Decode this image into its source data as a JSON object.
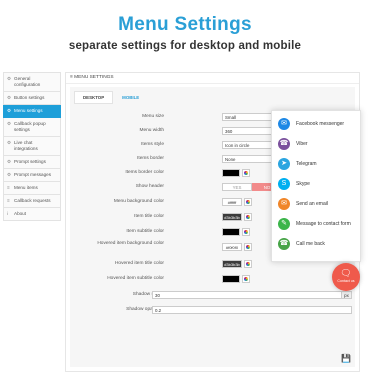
{
  "hero": {
    "title": "Menu Settings",
    "subtitle": "separate settings for desktop and mobile"
  },
  "sidebar": {
    "items": [
      {
        "icon": "gear-icon",
        "glyph": "⚙",
        "label": "General configuration",
        "active": false
      },
      {
        "icon": "gear-icon",
        "glyph": "⚙",
        "label": "Button settings",
        "active": false
      },
      {
        "icon": "gear-icon",
        "glyph": "⚙",
        "label": "Menu settings",
        "active": true
      },
      {
        "icon": "gear-icon",
        "glyph": "⚙",
        "label": "Callback popup settings",
        "active": false
      },
      {
        "icon": "gear-icon",
        "glyph": "⚙",
        "label": "Live chat integrations",
        "active": false
      },
      {
        "icon": "gear-icon",
        "glyph": "⚙",
        "label": "Prompt settings",
        "active": false
      },
      {
        "icon": "gear-icon",
        "glyph": "⚙",
        "label": "Prompt messages",
        "active": false
      },
      {
        "icon": "list-icon",
        "glyph": "≡",
        "label": "Menu items",
        "active": false
      },
      {
        "icon": "list-icon",
        "glyph": "≡",
        "label": "Callback requests",
        "active": false
      },
      {
        "icon": "info-icon",
        "glyph": "i",
        "label": "About",
        "active": false
      }
    ]
  },
  "panel": {
    "title": "MENU SETTINGS",
    "title_icon": "≡",
    "tabs": [
      {
        "label": "DESKTOP",
        "active": true
      },
      {
        "label": "MOBILE",
        "active": false
      }
    ]
  },
  "form": {
    "menu_size": {
      "label": "Menu size",
      "value": "Small"
    },
    "menu_width": {
      "label": "Menu width",
      "value": "360",
      "unit": "px"
    },
    "items_style": {
      "label": "Items style",
      "value": "Icon in circle"
    },
    "items_border": {
      "label": "Items border",
      "value": "None"
    },
    "items_border_color": {
      "label": "Items border color",
      "color": "#000000"
    },
    "show_header": {
      "label": "Show header",
      "yes": "YES",
      "no": "NO"
    },
    "menu_bg_color": {
      "label": "Menu background color",
      "value": "#ffffff"
    },
    "item_title_color": {
      "label": "Item title color",
      "value": "#3b3b3b",
      "color": "#3b3b3b"
    },
    "item_subtitle_color": {
      "label": "Item subtitle color",
      "color": "#000000"
    },
    "hovered_bg_color": {
      "label": "Hovered item background color",
      "value": "#f0f0f0"
    },
    "hovered_title_color": {
      "label": "Hovered item title color",
      "value": "#3b3b3b",
      "color": "#3b3b3b"
    },
    "hovered_subtitle_color": {
      "label": "Hovered item subtitle color",
      "color": "#000000"
    },
    "shadow_size": {
      "label": "Shadow size",
      "value": "30",
      "unit": "px"
    },
    "shadow_opacity": {
      "label": "Shadow opacity",
      "value": "0.2"
    }
  },
  "preview": {
    "items": [
      {
        "label": "Facebook messenger",
        "icon": "messenger-icon",
        "glyph": "✉",
        "color": "#1e88e5"
      },
      {
        "label": "Viber",
        "icon": "viber-icon",
        "glyph": "☎",
        "color": "#7b519d"
      },
      {
        "label": "Telegram",
        "icon": "telegram-icon",
        "glyph": "➤",
        "color": "#2ca5e0"
      },
      {
        "label": "Skype",
        "icon": "skype-icon",
        "glyph": "S",
        "color": "#00aff0"
      },
      {
        "label": "Send an email",
        "icon": "email-icon",
        "glyph": "✉",
        "color": "#f0862a"
      },
      {
        "label": "Message to contact form",
        "icon": "contact-form-icon",
        "glyph": "✎",
        "color": "#3cb54a"
      },
      {
        "label": "Call me back",
        "icon": "phone-icon",
        "glyph": "☎",
        "color": "#47a447"
      }
    ],
    "fab_label": "Contact us",
    "fab_icon": "chat-icon",
    "fab_color": "#ef5a4b"
  },
  "colors": {
    "accent": "#1e9fd9",
    "toggle_no": "#f28b8b"
  }
}
